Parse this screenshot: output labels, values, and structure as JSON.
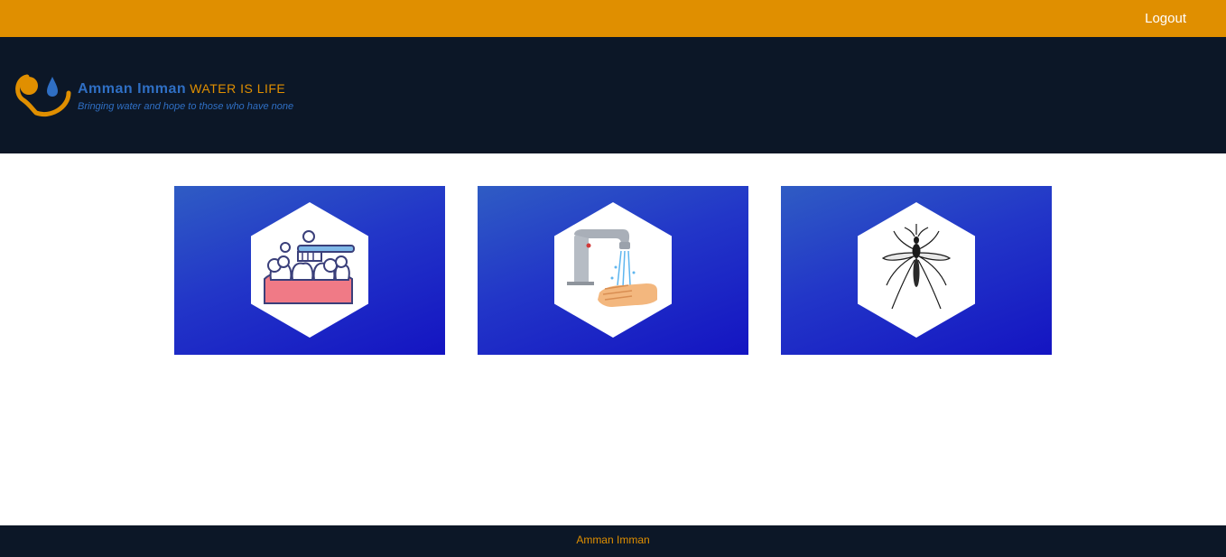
{
  "topbar": {
    "logout_label": "Logout"
  },
  "header": {
    "brand_name": "Amman Imman",
    "brand_tagline": "WATER IS LIFE",
    "brand_slogan": "Bringing water and hope to those who have none"
  },
  "cards": [
    {
      "icon": "tooth-brushing-icon"
    },
    {
      "icon": "hand-washing-faucet-icon"
    },
    {
      "icon": "mosquito-icon"
    }
  ],
  "footer": {
    "text": "Amman Imman"
  },
  "colors": {
    "topbar": "#e08f00",
    "header": "#0c1727",
    "brand_blue": "#2f6fc4",
    "card_gradient_start": "#2f5cc4",
    "card_gradient_end": "#1414c2"
  }
}
